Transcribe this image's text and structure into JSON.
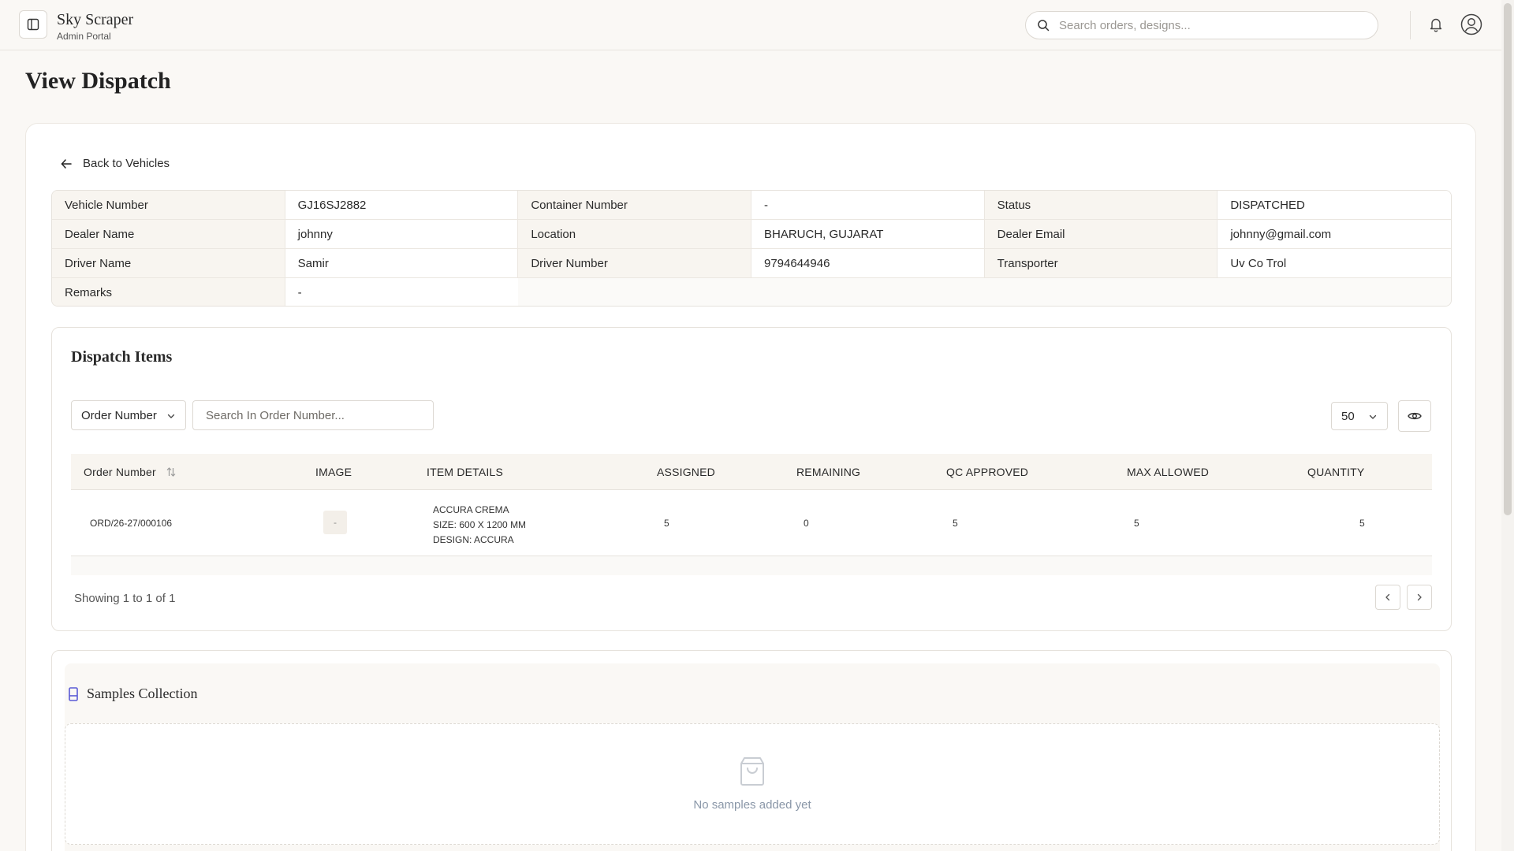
{
  "brand": {
    "title": "Sky Scraper",
    "subtitle": "Admin Portal"
  },
  "search": {
    "placeholder": "Search orders, designs..."
  },
  "page": {
    "title": "View Dispatch",
    "back_label": "Back to Vehicles"
  },
  "info": {
    "vehicle_number_label": "Vehicle Number",
    "vehicle_number": "GJ16SJ2882",
    "container_number_label": "Container Number",
    "container_number": "-",
    "status_label": "Status",
    "status": "DISPATCHED",
    "dealer_name_label": "Dealer Name",
    "dealer_name": "johnny",
    "location_label": "Location",
    "location": "BHARUCH, GUJARAT",
    "dealer_email_label": "Dealer Email",
    "dealer_email": "johnny@gmail.com",
    "driver_name_label": "Driver Name",
    "driver_name": "Samir",
    "driver_number_label": "Driver Number",
    "driver_number": "9794644946",
    "transporter_label": "Transporter",
    "transporter": "Uv Co Trol",
    "remarks_label": "Remarks",
    "remarks": "-"
  },
  "dispatch_items": {
    "title": "Dispatch Items",
    "filter_field": "Order Number",
    "filter_placeholder": "Search In Order Number...",
    "page_size": "50",
    "columns": [
      "Order Number",
      "IMAGE",
      "ITEM DETAILS",
      "ASSIGNED",
      "REMAINING",
      "QC APPROVED",
      "MAX ALLOWED",
      "QUANTITY"
    ],
    "rows": [
      {
        "order_number": "ORD/26-27/000106",
        "image": "-",
        "item_name": "ACCURA CREMA",
        "item_size": "SIZE: 600 X 1200 MM",
        "item_design": "DESIGN: ACCURA",
        "assigned": "5",
        "remaining": "0",
        "qc_approved": "5",
        "max_allowed": "5",
        "quantity": "5"
      }
    ],
    "showing": "Showing 1 to 1 of 1"
  },
  "samples": {
    "title": "Samples Collection",
    "empty_text": "No samples added yet"
  },
  "colors": {
    "accent": "#5b5bd6",
    "background": "#faf8f5",
    "label_bg": "#f8f5f0",
    "muted_text": "#8a97a8"
  }
}
